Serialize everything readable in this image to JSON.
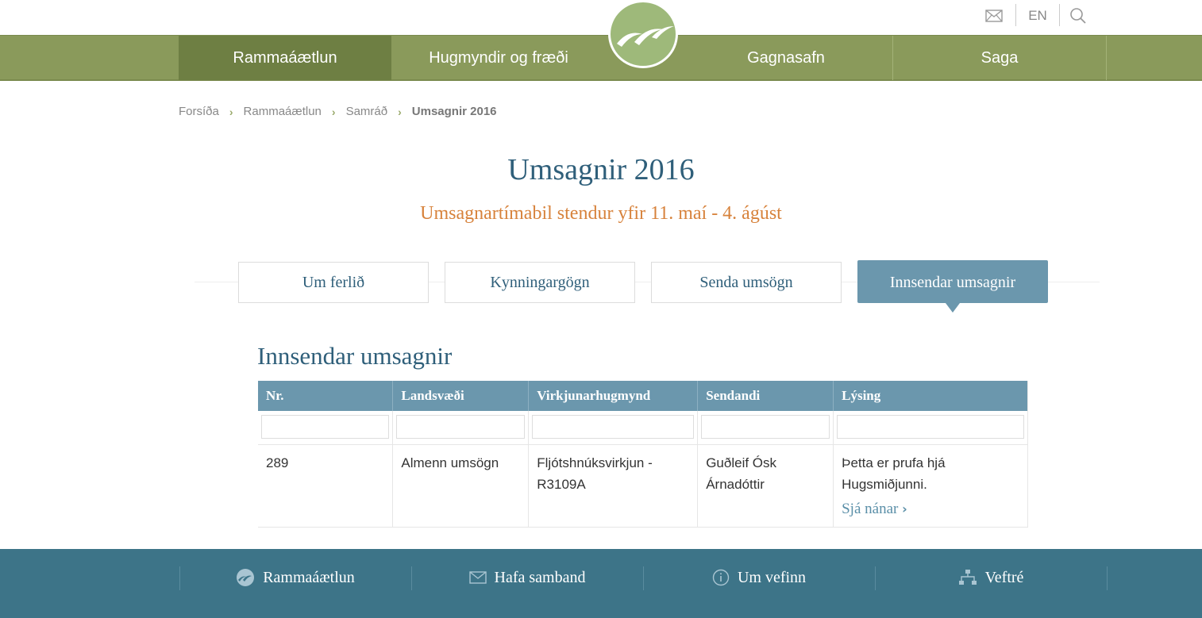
{
  "header": {
    "lang_label": "EN",
    "icons": [
      "mail-icon",
      "search-icon"
    ]
  },
  "nav": {
    "items": [
      "Rammaáætlun",
      "Hugmyndir og fræði",
      "Gagnasafn",
      "Saga"
    ],
    "active": "Rammaáætlun"
  },
  "breadcrumb": [
    "Forsíða",
    "Rammaáætlun",
    "Samráð",
    "Umsagnir 2016"
  ],
  "page": {
    "title": "Umsagnir 2016",
    "subtitle": "Umsagnartímabil stendur yfir 11. maí - 4. ágúst"
  },
  "tabs": [
    "Um ferlið",
    "Kynningargögn",
    "Senda umsögn",
    "Innsendar umsagnir"
  ],
  "active_tab": "Innsendar umsagnir",
  "section_title": "Innsendar umsagnir",
  "table": {
    "headers": [
      "Nr.",
      "Landsvæði",
      "Virkjunarhugmynd",
      "Sendandi",
      "Lýsing"
    ],
    "rows": [
      {
        "nr": "289",
        "landsvaedi": "Almenn umsögn",
        "virkjunarhugmynd": "Fljótshnúksvirkjun - R3109A",
        "sendandi": "Guðleif Ósk Árnadóttir",
        "lysing": "Þetta er prufa hjá Hugsmiðjunni.",
        "more_link": "Sjá nánar"
      }
    ]
  },
  "footer": {
    "items": [
      "Rammaáætlun",
      "Hafa samband",
      "Um vefinn",
      "Veftré"
    ]
  },
  "colors": {
    "nav_green": "#8a9a5b",
    "nav_active": "#6e7f43",
    "accent_blue": "#6b97ad",
    "title_blue": "#2f5f7a",
    "subtitle_orange": "#d7823b",
    "footer_teal": "#3d7488"
  }
}
